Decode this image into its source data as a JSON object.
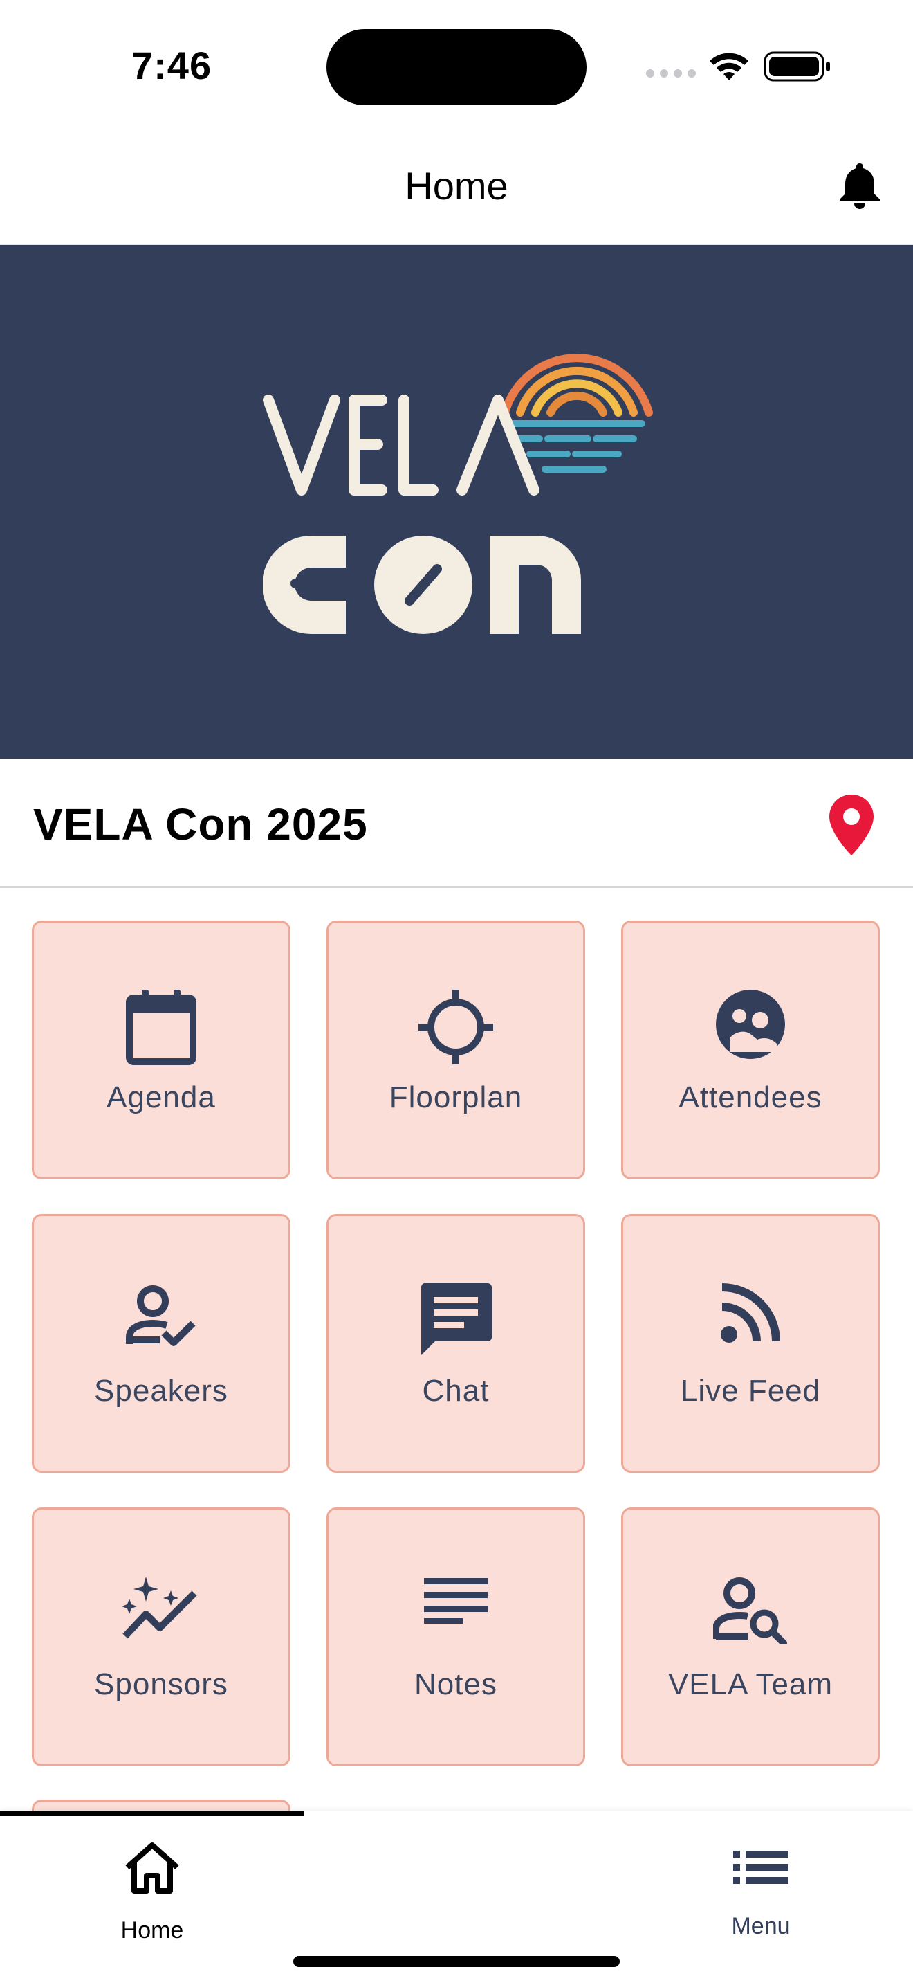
{
  "status_bar": {
    "time": "7:46"
  },
  "header": {
    "title": "Home"
  },
  "banner": {
    "logo_text_top": "VELA",
    "logo_text_bottom": "con"
  },
  "event": {
    "title": "VELA Con 2025"
  },
  "tiles": [
    {
      "label": "Agenda",
      "icon": "calendar-icon"
    },
    {
      "label": "Floorplan",
      "icon": "crosshair-icon"
    },
    {
      "label": "Attendees",
      "icon": "face-icon"
    },
    {
      "label": "Speakers",
      "icon": "person-check-icon"
    },
    {
      "label": "Chat",
      "icon": "chat-icon"
    },
    {
      "label": "Live Feed",
      "icon": "rss-icon"
    },
    {
      "label": "Sponsors",
      "icon": "sparkle-trend-icon"
    },
    {
      "label": "Notes",
      "icon": "notes-icon"
    },
    {
      "label": "VELA Team",
      "icon": "person-search-icon"
    }
  ],
  "tab_bar": {
    "items": [
      {
        "label": "Home",
        "icon": "home-icon",
        "active": true
      },
      {
        "label": "Menu",
        "icon": "list-icon",
        "active": false
      }
    ]
  },
  "colors": {
    "banner_bg": "#333f5a",
    "tile_bg": "#fbded8",
    "tile_border": "#eea897",
    "icon_color": "#333f5a",
    "pin_color": "#e8183a"
  }
}
